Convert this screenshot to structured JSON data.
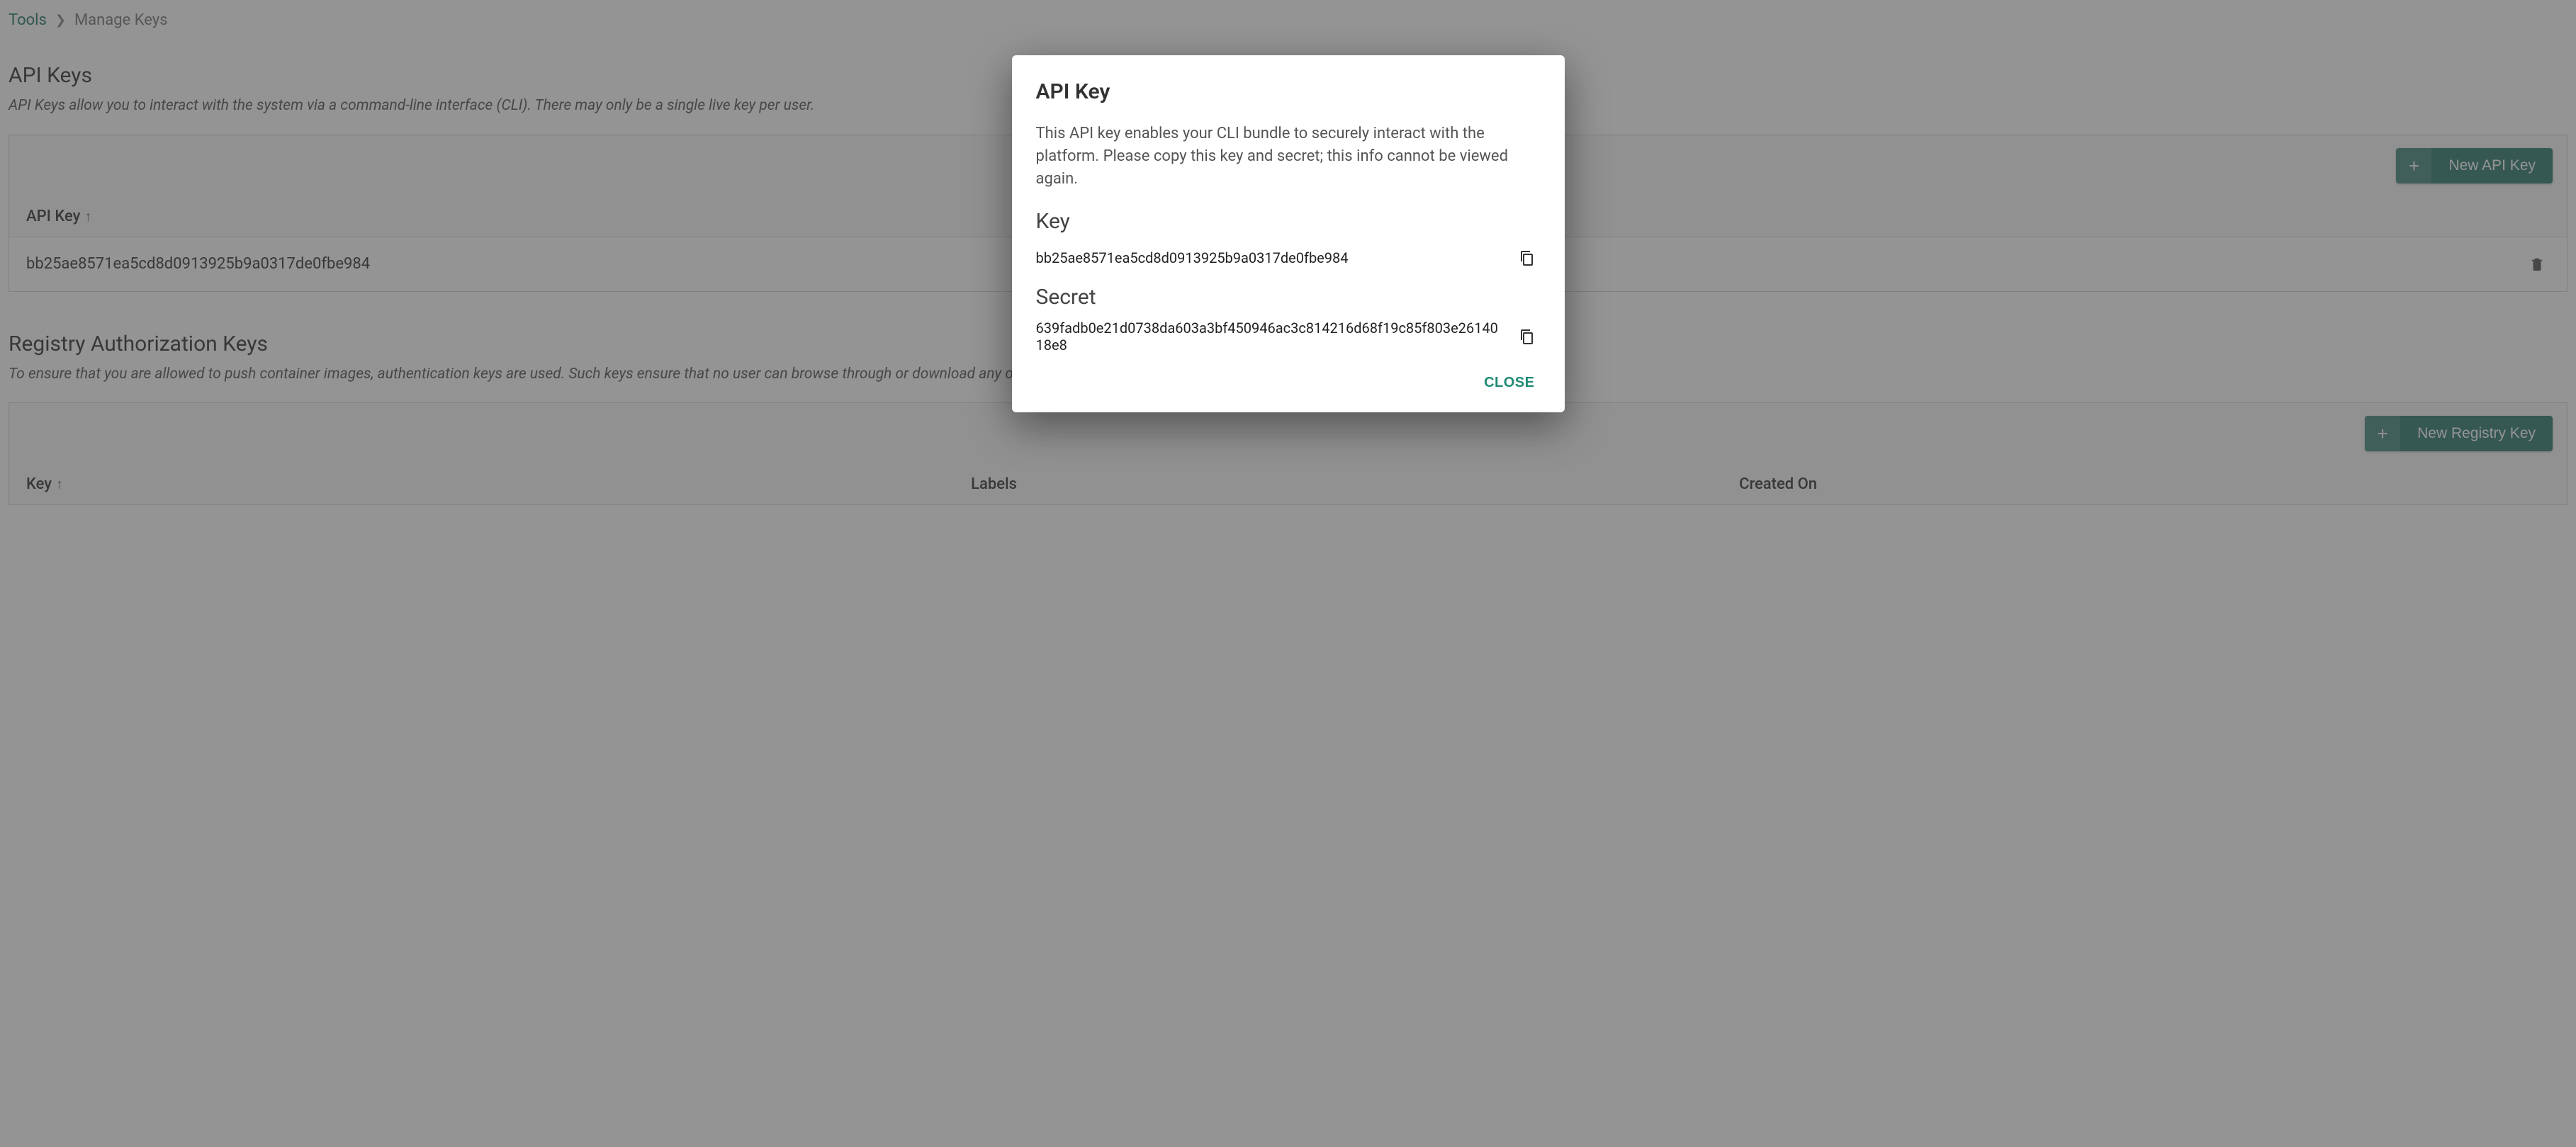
{
  "breadcrumb": {
    "root": "Tools",
    "current": "Manage Keys"
  },
  "api_keys": {
    "heading": "API Keys",
    "description": "API Keys allow you to interact with the system via a command-line interface (CLI). There may only be a single live key per user.",
    "new_button": "New API Key",
    "columns": {
      "key": "API Key"
    },
    "rows": [
      {
        "key": "bb25ae8571ea5cd8d0913925b9a0317de0fbe984"
      }
    ]
  },
  "registry_keys": {
    "heading": "Registry Authorization Keys",
    "description": "To ensure that you are allowed to push container images, authentication keys are used. Such keys ensure that no user can browse through or download any other user's container images.",
    "new_button": "New Registry Key",
    "columns": {
      "key": "Key",
      "labels": "Labels",
      "created": "Created On"
    }
  },
  "dialog": {
    "title": "API Key",
    "description": "This API key enables your CLI bundle to securely interact with the platform. Please copy this key and secret; this info cannot be viewed again.",
    "key_label": "Key",
    "key_value": "bb25ae8571ea5cd8d0913925b9a0317de0fbe984",
    "secret_label": "Secret",
    "secret_value": "639fadb0e21d0738da603a3bf450946ac3c814216d68f19c85f803e2614018e8",
    "close": "CLOSE"
  }
}
